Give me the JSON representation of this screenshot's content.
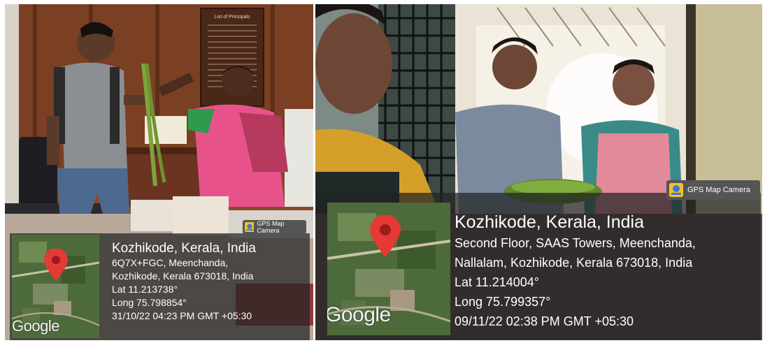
{
  "photos": [
    {
      "badge_label": "GPS Map Camera",
      "map_brand": "Google",
      "location": "Kozhikode, Kerala, India",
      "address_line1": "6Q7X+FGC, Meenchanda,",
      "address_line2": "Kozhikode, Kerala 673018, India",
      "lat": "Lat 11.213738°",
      "long": "Long 75.798854°",
      "timestamp": "31/10/22 04:23 PM GMT +05:30"
    },
    {
      "badge_label": "GPS Map Camera",
      "map_brand": "Google",
      "location": "Kozhikode, Kerala, India",
      "address_line1": "Second Floor, SAAS Towers, Meenchanda,",
      "address_line2": "Nallalam, Kozhikode, Kerala 673018, India",
      "lat": "Lat 11.214004°",
      "long": "Long 75.799357°",
      "timestamp": "09/11/22 02:38 PM GMT +05:30"
    }
  ],
  "wall_board": {
    "title": "List of Principals"
  },
  "colors": {
    "pin": "#e53935",
    "overlay": "#232323",
    "map_green": "#4d6b3a"
  }
}
